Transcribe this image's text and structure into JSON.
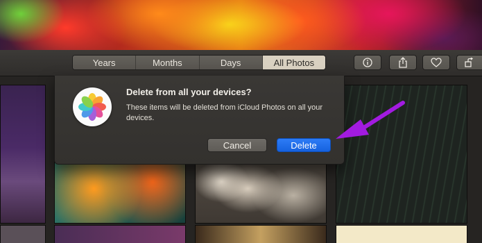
{
  "toolbar": {
    "tabs": [
      {
        "label": "Years"
      },
      {
        "label": "Months"
      },
      {
        "label": "Days"
      },
      {
        "label": "All Photos"
      }
    ],
    "active_tab": "All Photos",
    "icons": [
      "info-icon",
      "share-icon",
      "heart-icon",
      "rotate-icon"
    ]
  },
  "dialog": {
    "title": "Delete from all your devices?",
    "message": "These items will be deleted from iCloud Photos on all your devices.",
    "cancel_label": "Cancel",
    "delete_label": "Delete",
    "app_icon": "photos-app-icon"
  },
  "colors": {
    "accent_button": "#1f6fef",
    "annotation_arrow": "#a21be0",
    "active_tab": "#d9d1c1"
  }
}
